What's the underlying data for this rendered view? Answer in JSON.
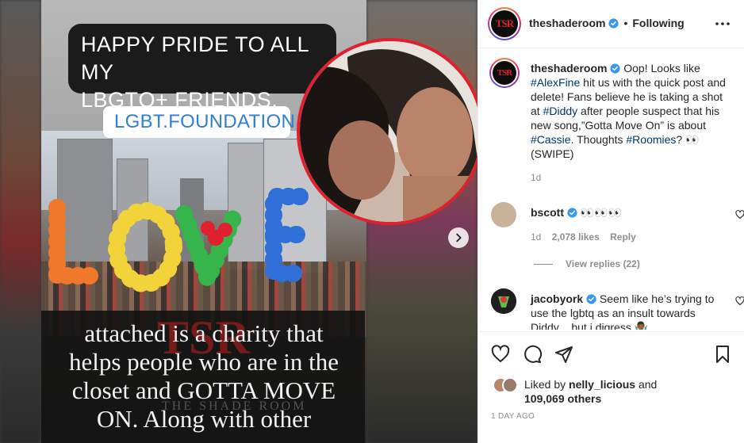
{
  "post": {
    "story_banner": [
      "HAPPY PRIDE TO ALL MY",
      "LBGTQ+ FRIENDS."
    ],
    "link_sticker": "LGBT.FOUNDATION",
    "balloon_word": "LOVE",
    "story_caption": [
      "attached is a charity that",
      "helps people who are in the",
      "closet and GOTTA MOVE",
      "ON. Along with other"
    ],
    "watermark": "THE SHADE ROOM",
    "watermark_logo": "TSR"
  },
  "header": {
    "username": "theshaderoom",
    "separator": "•",
    "follow_state": "Following",
    "avatar_logo": "TSR"
  },
  "caption": {
    "username": "theshaderoom",
    "parts": [
      {
        "t": "Oop! Looks like ",
        "tag": false
      },
      {
        "t": "#AlexFine",
        "tag": true
      },
      {
        "t": " hit us with the quick post and delete! Fans believe he is taking a shot at ",
        "tag": false
      },
      {
        "t": "#Diddy",
        "tag": true
      },
      {
        "t": " after people suspect that his new song,”Gotta Move On” is about ",
        "tag": false
      },
      {
        "t": "#Cassie",
        "tag": true
      },
      {
        "t": ". Thoughts ",
        "tag": false
      },
      {
        "t": "#Roomies",
        "tag": true
      },
      {
        "t": "? 👀 (SWIPE)",
        "tag": false
      }
    ],
    "age": "1d"
  },
  "comments": [
    {
      "username": "bscott",
      "text": "👀👀👀",
      "age": "1d",
      "likes": "2,078 likes",
      "reply": "Reply",
      "view_replies": "View replies (22)"
    },
    {
      "username": "jacobyork",
      "text": "Seem like he’s trying to use the lgbtq as an insult towards Diddy .. but i digress 🤷🏾‍♂️"
    }
  ],
  "likes": {
    "prefix": "Liked by ",
    "user": "nelly_licious",
    "middle": " and",
    "count": "109,069 others"
  },
  "timestamp": "1 DAY AGO",
  "colors": {
    "link": "#00376b",
    "verified": "#3897f0",
    "accent_red": "#e0202e"
  }
}
